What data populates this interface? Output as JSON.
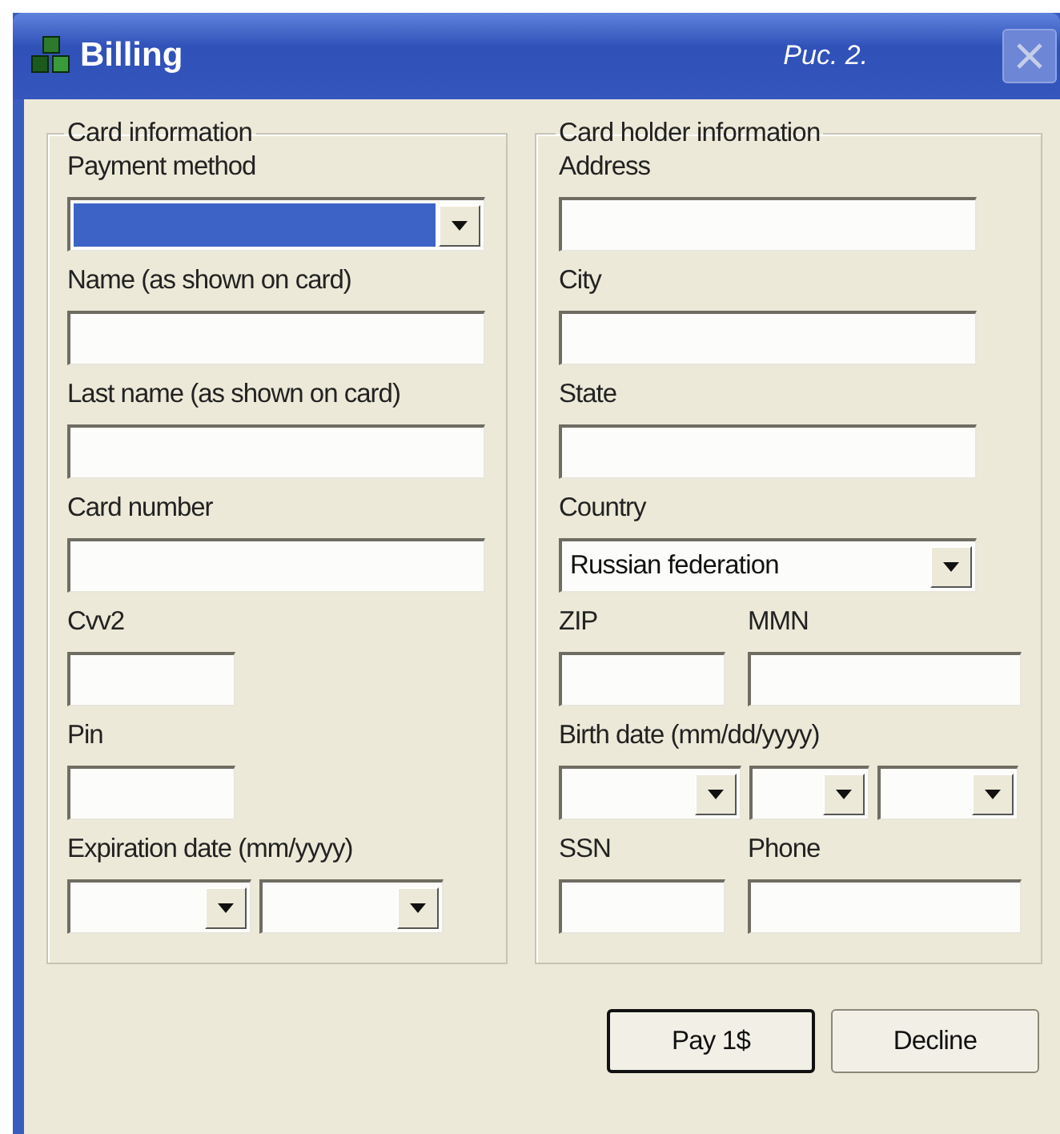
{
  "window": {
    "title": "Billing",
    "caption": "Рис. 2."
  },
  "groups": [
    {
      "title": "Card information",
      "items": [
        {
          "kind": "select",
          "label": "Payment method",
          "highlighted": true
        },
        {
          "kind": "text",
          "label": "Name (as shown on card)"
        },
        {
          "kind": "text",
          "label": "Last name (as shown on card)"
        },
        {
          "kind": "text",
          "label": "Card number"
        },
        {
          "kind": "short",
          "label": "Cvv2"
        },
        {
          "kind": "short",
          "label": "Pin"
        },
        {
          "kind": "monthyear",
          "label": "Expiration date (mm/yyyy)"
        }
      ]
    },
    {
      "title": "Card holder information",
      "items": [
        {
          "kind": "text",
          "label": "Address"
        },
        {
          "kind": "text",
          "label": "City"
        },
        {
          "kind": "text",
          "label": "State"
        },
        {
          "kind": "select",
          "label": "Country",
          "value": "Russian federation",
          "highlighted": false
        },
        {
          "kind": "pair",
          "labels": [
            "ZIP",
            "MMN"
          ]
        },
        {
          "kind": "fulldate",
          "label": "Birth date (mm/dd/yyyy)"
        },
        {
          "kind": "pair",
          "labels": [
            "SSN",
            "Phone"
          ]
        }
      ]
    }
  ],
  "buttons": [
    {
      "label": "Pay 1$",
      "default": true
    },
    {
      "label": "Decline",
      "default": false
    }
  ]
}
